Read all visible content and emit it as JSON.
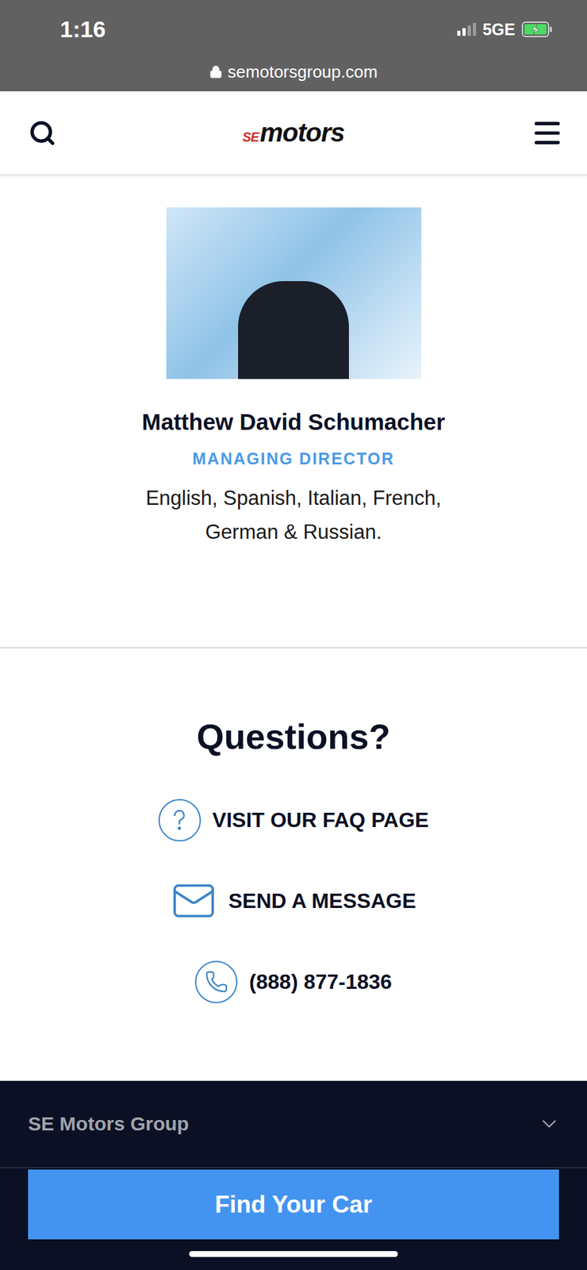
{
  "status_bar": {
    "time": "1:16",
    "network": "5GE",
    "signal_level": 0.5,
    "charging": true
  },
  "address_bar": {
    "url": "semotorsgroup.com"
  },
  "header": {
    "logo": {
      "prefix": "SE",
      "name": "motors"
    }
  },
  "profile": {
    "name": "Matthew David Schumacher",
    "title": "MANAGING DIRECTOR",
    "languages": "English, Spanish, Italian, French, German & Russian."
  },
  "questions": {
    "title": "Questions?",
    "items": [
      {
        "label": "VISIT OUR FAQ PAGE",
        "kind": "faq"
      },
      {
        "label": "SEND A MESSAGE",
        "kind": "message"
      },
      {
        "label": "(888) 877-1836",
        "kind": "phone"
      }
    ]
  },
  "footer": {
    "section": {
      "label": "SE Motors Group",
      "expanded": false
    },
    "cta": "Find Your Car"
  }
}
